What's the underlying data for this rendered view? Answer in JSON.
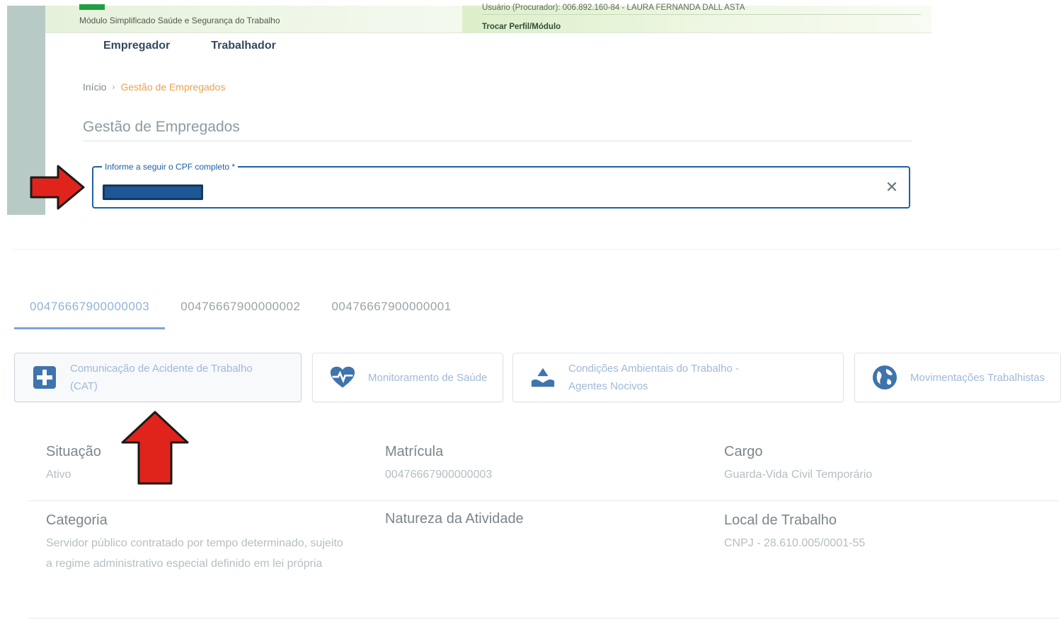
{
  "header": {
    "module_name": "Módulo Simplificado Saúde e Segurança do Trabalho",
    "user_line": "Usuário (Procurador): 006.892.160-84 - LAURA FERNANDA DALL ASTA",
    "profile_link": "Trocar Perfil/Módulo"
  },
  "nav": {
    "items": [
      {
        "label": "Empregador"
      },
      {
        "label": "Trabalhador"
      }
    ]
  },
  "breadcrumb": {
    "home": "Início",
    "separator": "›",
    "current": "Gestão de Empregados"
  },
  "page": {
    "title": "Gestão de Empregados"
  },
  "cpf": {
    "label": "Informe a seguir o CPF completo *",
    "clear_glyph": "✕",
    "value_redacted": true
  },
  "tabs": [
    {
      "label": "00476667900000003",
      "active": true
    },
    {
      "label": "00476667900000002",
      "active": false
    },
    {
      "label": "00476667900000001",
      "active": false
    }
  ],
  "cards": [
    {
      "label": "Comunicação de Acidente de Trabalho (CAT)",
      "icon": "plus-icon"
    },
    {
      "label": "Monitoramento de Saúde",
      "icon": "heartbeat-icon"
    },
    {
      "label": "Condições Ambientais do Trabalho - Agentes Nocivos",
      "icon": "hazard-hands-icon"
    },
    {
      "label": "Movimentações Trabalhistas",
      "icon": "globe-icon"
    }
  ],
  "details": {
    "row1": [
      {
        "label": "Situação",
        "value": "Ativo"
      },
      {
        "label": "Matrícula",
        "value": "00476667900000003"
      },
      {
        "label": "Cargo",
        "value": "Guarda-Vida Civil Temporário"
      }
    ],
    "row2": [
      {
        "label": "Categoria",
        "value": "Servidor público contratado por tempo determinado, sujeito a regime administrativo especial definido em lei própria"
      },
      {
        "label": "Natureza da Atividade",
        "value": ""
      },
      {
        "label": "Local de Trabalho",
        "value": "CNPJ - 28.610.005/0001-55"
      }
    ]
  },
  "colors": {
    "accent_blue": "#1f5fa6",
    "breadcrumb_current": "#e8a34c",
    "annotation_red": "#e0241b"
  }
}
